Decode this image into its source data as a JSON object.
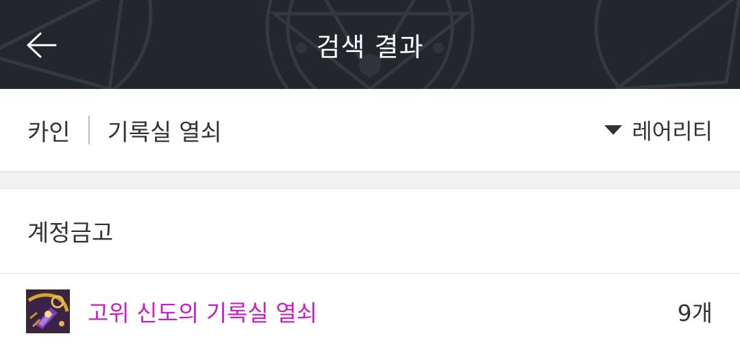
{
  "header": {
    "title": "검색 결과",
    "back_icon": "arrow-left-icon",
    "background_color": "#23262d"
  },
  "filter": {
    "server": "카인",
    "keyword": "기록실 열쇠",
    "sort_label": "레어리티",
    "sort_icon": "caret-down-icon"
  },
  "section": {
    "title": "계정금고"
  },
  "results": [
    {
      "name": "고위 신도의 기록실 열쇠",
      "count": "9개",
      "icon": "key-item-icon",
      "rarity_color": "#c81ec8"
    }
  ]
}
